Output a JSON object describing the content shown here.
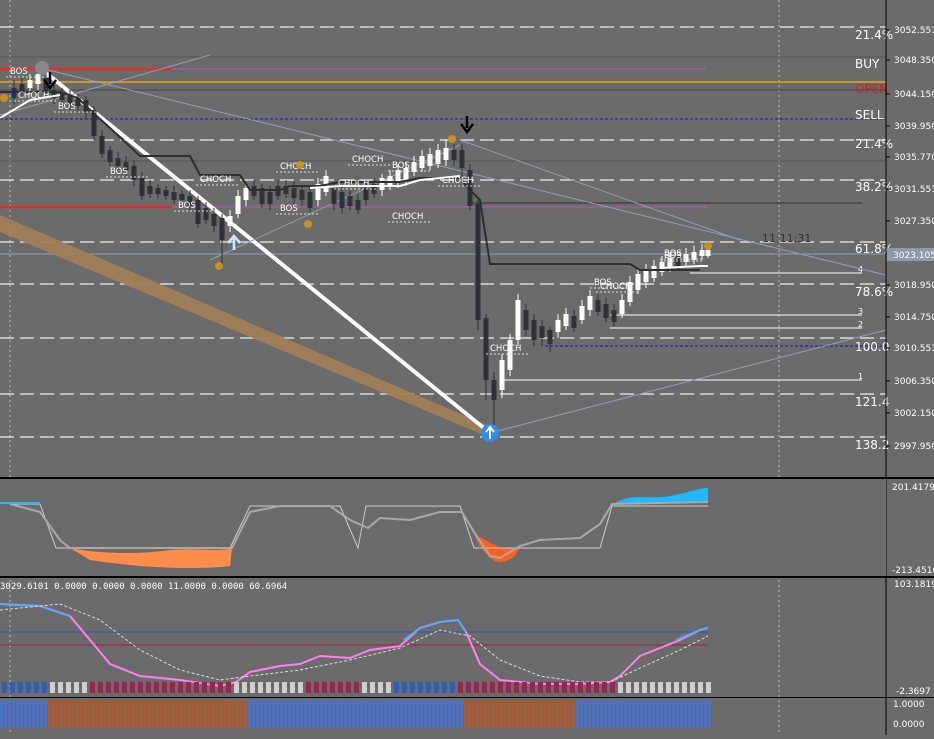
{
  "colors": {
    "background": "#6b6b6b",
    "bull": "#ffffff",
    "bear": "#2f3238",
    "fib_line": "#ffffff",
    "red_line": "#ff2020",
    "orange_line": "#c8952a",
    "magenta_line": "#c050c0",
    "blue_dotted": "#1010c0",
    "trend_white": "#ffffff",
    "trend_tan": "#a08058",
    "osc_orange": "#ff8c4a",
    "osc_blue": "#20b8ff",
    "rsi_blue": "#5aa8ff",
    "rsi_pink": "#ff7ff0",
    "panel_border": "#000000"
  },
  "price_axis": {
    "labels": [
      "3052.551",
      "3048.350",
      "3044.150",
      "3039.950",
      "3035.770",
      "3031.551",
      "3027.350",
      "3023.105",
      "3018.950",
      "3014.750",
      "3010.551",
      "3006.350",
      "3002.150",
      "2997.950"
    ],
    "current_price": "3023.105"
  },
  "fib_levels": [
    {
      "label": "21.4%"
    },
    {
      "label": "BUY"
    },
    {
      "label": "OPEN"
    },
    {
      "label": "SELL"
    },
    {
      "label": "21.4%"
    },
    {
      "label": "38.2%"
    },
    {
      "label": "61.8%"
    },
    {
      "label": "78.6%"
    },
    {
      "label": "100.0"
    },
    {
      "label": "121.4"
    },
    {
      "label": "138.2"
    }
  ],
  "tp_levels": [
    "4",
    "3",
    "2",
    "1"
  ],
  "time_readout": "11:11:31",
  "structure_labels": [
    "BOS",
    "CHOCH",
    "BOS",
    "BOS",
    "CHOCH",
    "BOS",
    "CHOCH",
    "BOS",
    "CHOCH",
    "BOS",
    "CHOCH",
    "CHOCH",
    "CHOCH",
    "CHOCH",
    "BOS",
    "CHOCH",
    "BOS",
    "BOS"
  ],
  "osc_panel": {
    "max_label": "201.4179",
    "min_label": "-213.4510"
  },
  "rsi_panel": {
    "readout": "3029.6101 0.0000 0.0000 0.0000 11.0000 0.0000 60.6964",
    "max_label": "103.1819",
    "min_label": "-2.3697"
  },
  "bottom_panel": {
    "max_label": "1.0000",
    "min_label": "0.0000"
  }
}
